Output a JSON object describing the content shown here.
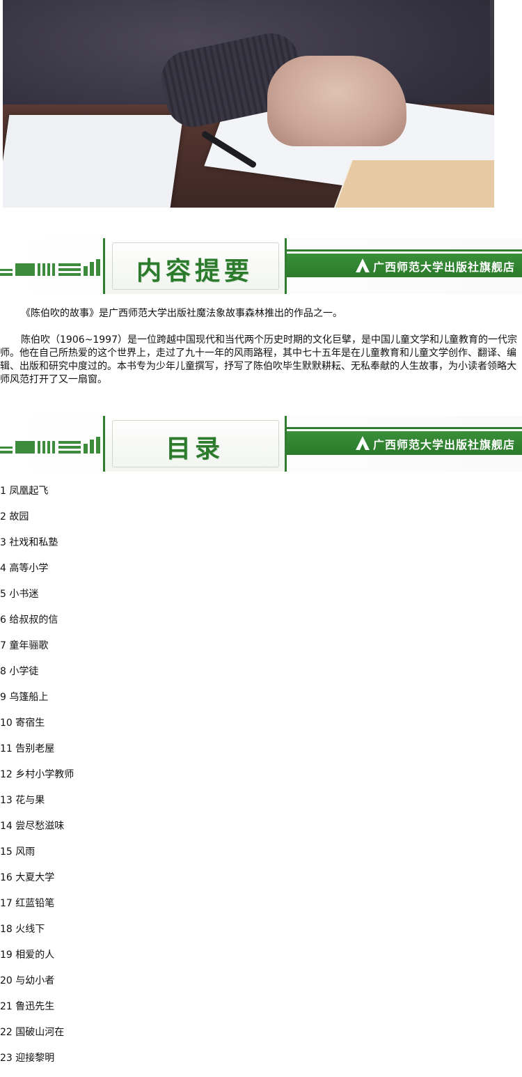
{
  "banners": [
    {
      "title": "内容提要",
      "brand": "广西师范大学出版社旗舰店"
    },
    {
      "title": "目录",
      "brand": "广西师范大学出版社旗舰店"
    }
  ],
  "summary": {
    "p1": "《陈伯吹的故事》是广西师范大学出版社魔法象故事森林推出的作品之一。",
    "p2": "陈伯吹（1906~1997）是一位跨越中国现代和当代两个历史时期的文化巨擘，是中国儿童文学和儿童教育的一代宗师。他在自己所热爱的这个世界上，走过了九十一年的风雨路程，其中七十五年是在儿童教育和儿童文学创作、翻译、编辑、出版和研究中度过的。本书专为少年儿童撰写，抒写了陈伯吹毕生默默耕耘、无私奉献的人生故事，为小读者领略大师风范打开了又一扇窗。"
  },
  "toc": [
    "1 凤凰起飞",
    "2 故园",
    "3 社戏和私塾",
    "4 高等小学",
    "5 小书迷",
    "6 给叔叔的信",
    "7 童年骊歌",
    "8 小学徒",
    "9 乌篷船上",
    "10 寄宿生",
    "11 告别老屋",
    "12 乡村小学教师",
    "13 花与果",
    "14 尝尽愁滋味",
    "15 风雨",
    "16 大夏大学",
    "17 红蓝铅笔",
    "18 火线下",
    "19 相爱的人",
    "20 与幼小者",
    "21 鲁迅先生",
    "22 国破山河在",
    "23 迎接黎明"
  ],
  "colors": {
    "brand_green": "#2c7a2c",
    "strip_green": "#2a7a2a"
  }
}
